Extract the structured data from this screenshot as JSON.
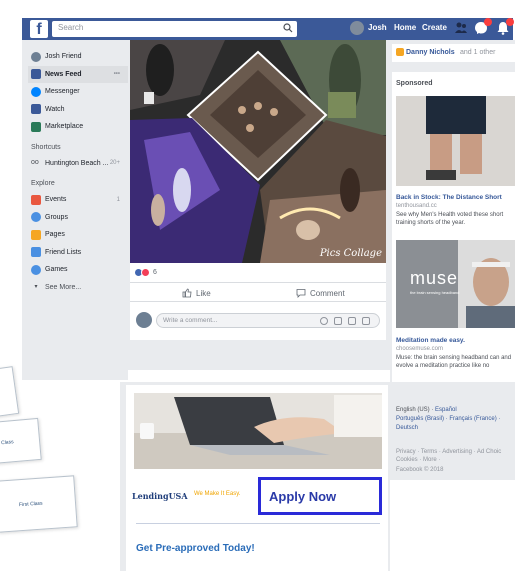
{
  "topbar": {
    "search_placeholder": "Search",
    "user_name": "Josh",
    "home_label": "Home",
    "create_label": "Create"
  },
  "left_nav": {
    "profile": "Josh Friend",
    "items": [
      {
        "label": "News Feed",
        "icon": "news-feed-icon",
        "color": "#3b5998"
      },
      {
        "label": "Messenger",
        "icon": "messenger-icon",
        "color": "#0084ff"
      },
      {
        "label": "Watch",
        "icon": "watch-icon",
        "color": "#3b5998"
      },
      {
        "label": "Marketplace",
        "icon": "marketplace-icon",
        "color": "#2a7a58"
      }
    ],
    "shortcuts_heading": "Shortcuts",
    "shortcut": {
      "label": "Huntington Beach ...",
      "count": "20+"
    },
    "explore_heading": "Explore",
    "explore": [
      {
        "label": "Events",
        "icon": "events-icon",
        "color": "#e9573f",
        "count": "1"
      },
      {
        "label": "Groups",
        "icon": "groups-icon",
        "color": "#4a90e2",
        "count": ""
      },
      {
        "label": "Pages",
        "icon": "pages-icon",
        "color": "#f5a623",
        "count": ""
      },
      {
        "label": "Friend Lists",
        "icon": "friend-lists-icon",
        "color": "#4a90e2",
        "count": ""
      },
      {
        "label": "Games",
        "icon": "games-icon",
        "color": "#4a90e2",
        "count": ""
      }
    ],
    "see_more": "See More..."
  },
  "post": {
    "watermark": "Pics Collage",
    "reaction_count": "6",
    "like_label": "Like",
    "comment_label": "Comment",
    "comment_placeholder": "Write a comment..."
  },
  "right": {
    "birthday_name": "Danny Nichols",
    "birthday_rest": "and 1 other",
    "sponsored_heading": "Sponsored",
    "ad1": {
      "title": "Back in Stock: The Distance Short",
      "domain": "tenthousand.cc",
      "body": "See why Men's Health voted these short training shorts of the year."
    },
    "ad2": {
      "logo": "muse",
      "logo_tagline": "the brain sensing headband",
      "title": "Meditation made easy.",
      "domain": "choosemuse.com",
      "body": "Muse: the brain sensing headband can and evolve a meditation practice like no"
    },
    "footer": {
      "languages_1": "English (US) · ",
      "language_link_1": "Español",
      "languages_2": "Português (Brasil) · Français (France) ·",
      "languages_3": "Deutsch",
      "legal": "Privacy · Terms · Advertising · Ad Choic Cookies · More ·",
      "copyright": "Facebook © 2018"
    }
  },
  "banner": {
    "brand": "LendingUSA",
    "tagline": "We Make It Easy.",
    "apply_label": "Apply Now",
    "preapproved": "Get Pre-approved Today!"
  },
  "cards": {
    "card2": "Class",
    "card3": "First Class"
  }
}
